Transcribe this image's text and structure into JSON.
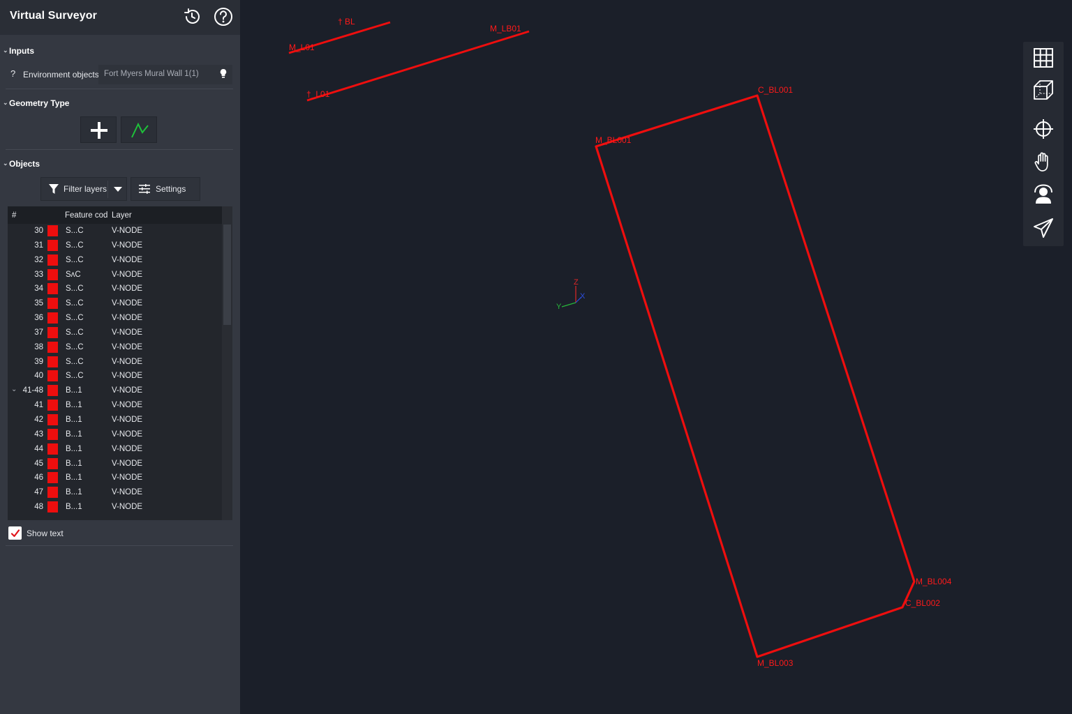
{
  "app": {
    "title": "Virtual Surveyor"
  },
  "header": {
    "history_icon": "history-icon",
    "help_icon": "help-icon"
  },
  "inputs": {
    "section_label": "Inputs",
    "environment": {
      "qmark": "?",
      "label": "Environment objects",
      "value": "Fort Myers Mural Wall 1(1)"
    }
  },
  "geometry": {
    "section_label": "Geometry Type",
    "buttons": [
      {
        "icon": "plus-icon"
      },
      {
        "icon": "polyline-icon"
      }
    ]
  },
  "objects": {
    "section_label": "Objects",
    "filter_label": "Filter layers",
    "settings_label": "Settings",
    "columns": {
      "num": "#",
      "code": "Feature cod",
      "layer": "Layer"
    },
    "rows": [
      {
        "num": "30",
        "code": "S...C",
        "layer": "V-NODE",
        "expand": ""
      },
      {
        "num": "31",
        "code": "S...C",
        "layer": "V-NODE",
        "expand": ""
      },
      {
        "num": "32",
        "code": "S...C",
        "layer": "V-NODE",
        "expand": ""
      },
      {
        "num": "33",
        "code": "SʌC",
        "layer": "V-NODE",
        "expand": ""
      },
      {
        "num": "34",
        "code": "S...C",
        "layer": "V-NODE",
        "expand": ""
      },
      {
        "num": "35",
        "code": "S...C",
        "layer": "V-NODE",
        "expand": ""
      },
      {
        "num": "36",
        "code": "S...C",
        "layer": "V-NODE",
        "expand": ""
      },
      {
        "num": "37",
        "code": "S...C",
        "layer": "V-NODE",
        "expand": ""
      },
      {
        "num": "38",
        "code": "S...C",
        "layer": "V-NODE",
        "expand": ""
      },
      {
        "num": "39",
        "code": "S...C",
        "layer": "V-NODE",
        "expand": ""
      },
      {
        "num": "40",
        "code": "S...C",
        "layer": "V-NODE",
        "expand": ""
      },
      {
        "num": "41-48",
        "code": "B...1",
        "layer": "V-NODE",
        "expand": "⌄"
      },
      {
        "num": "41",
        "code": "B...1",
        "layer": "V-NODE",
        "expand": ""
      },
      {
        "num": "42",
        "code": "B...1",
        "layer": "V-NODE",
        "expand": ""
      },
      {
        "num": "43",
        "code": "B...1",
        "layer": "V-NODE",
        "expand": ""
      },
      {
        "num": "44",
        "code": "B...1",
        "layer": "V-NODE",
        "expand": ""
      },
      {
        "num": "45",
        "code": "B...1",
        "layer": "V-NODE",
        "expand": ""
      },
      {
        "num": "46",
        "code": "B...1",
        "layer": "V-NODE",
        "expand": ""
      },
      {
        "num": "47",
        "code": "B...1",
        "layer": "V-NODE",
        "expand": ""
      },
      {
        "num": "48",
        "code": "B...1",
        "layer": "V-NODE",
        "expand": ""
      }
    ],
    "swatch_color": "#ee0e0e"
  },
  "show_text": {
    "label": "Show text",
    "checked": true
  },
  "viewport": {
    "line_color": "#ee0e0e",
    "labels": {
      "c_bl001": "C_BL001",
      "m_bl001": "M_BL001",
      "m_bl004": "M_BL004",
      "c_bl002": "C_BL002",
      "m_bl003": "M_BL003",
      "top_a": "† BL",
      "top_b": "M_L01",
      "top_c": "M_LB01",
      "top_d": "†_L01"
    },
    "axes": {
      "z": "Z",
      "x": "X",
      "y": "Y"
    }
  },
  "toolbar": {
    "tools": [
      {
        "icon": "grid-icon"
      },
      {
        "icon": "cube-icon"
      },
      {
        "icon": "crosshair-icon"
      },
      {
        "icon": "hand-icon"
      },
      {
        "icon": "person-orbit-icon"
      },
      {
        "icon": "send-icon"
      }
    ]
  }
}
